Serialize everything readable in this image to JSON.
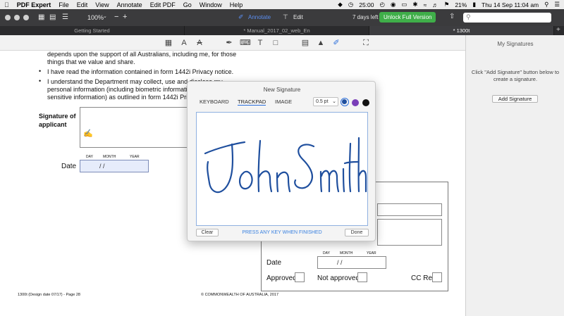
{
  "menubar": {
    "apple": "",
    "app": "PDF Expert",
    "items": [
      "File",
      "Edit",
      "View",
      "Annotate",
      "Edit PDF",
      "Go",
      "Window",
      "Help"
    ],
    "status": {
      "battery_time": "25:00",
      "battery_pct": "21%",
      "datetime": "Thu 14 Sep  11:04 am"
    }
  },
  "toolbar": {
    "zoom": "100%",
    "zoom_minus": "−",
    "zoom_plus": "+",
    "annotate": "Annotate",
    "edit": "Edit",
    "trial": "7 days left",
    "unlock": "Unlock Full Version"
  },
  "tabs": [
    {
      "label": "Getting Started",
      "active": false
    },
    {
      "label": "* Manual_2017_02_web_En",
      "active": false
    },
    {
      "label": "* 1300t",
      "active": true
    }
  ],
  "tab_add": "+",
  "document": {
    "line1": "depends upon the support of all Australians, including me, for those",
    "line2": "things that we value and share.",
    "bullet1": "I have read the information contained in form 1442i Privacy notice.",
    "bullet2a": "I understand the Department may collect, use and disclose my",
    "bullet2b": "personal information (including biometric information",
    "bullet2c": "sensitive information) as outlined in form 1442i Privacy",
    "sig_label1": "Signature of",
    "sig_label2": "applicant",
    "day": "DAY",
    "month": "MONTH",
    "year": "YEAR",
    "date_label": "Date",
    "date_sep": "/          /",
    "date_label2": "Date",
    "approved": "Approved",
    "not_approved": "Not approved",
    "cc_ref": "CC Ref",
    "footer_left": "1300t (Design date 07/17) - Page 28",
    "footer_center": "© COMMONWEALTH OF AUSTRALIA, 2017"
  },
  "sidebar": {
    "title": "My Signatures",
    "hint": "Click \"Add Signature\" button below to create a signature.",
    "add_button": "Add Signature"
  },
  "modal": {
    "title": "New Signature",
    "tabs": [
      "KEYBOARD",
      "TRACKPAD",
      "IMAGE"
    ],
    "active_tab": "TRACKPAD",
    "stroke": "0.5 pt",
    "colors": [
      "#1f4f9e",
      "#7a3fb8",
      "#111111"
    ],
    "selected_color": "#1f4f9e",
    "signature": "John Smith",
    "clear": "Clear",
    "hint": "PRESS ANY KEY WHEN FINISHED",
    "done": "Done"
  }
}
